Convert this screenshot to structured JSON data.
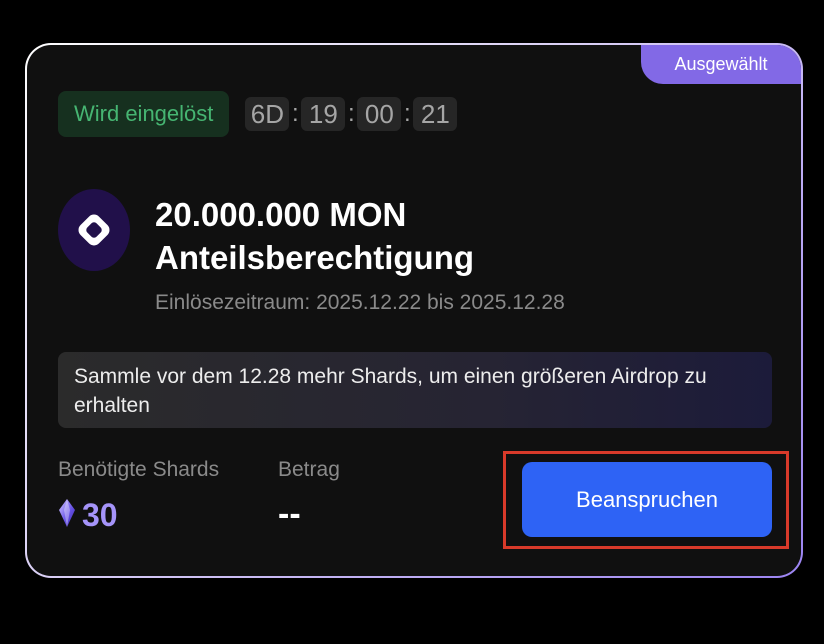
{
  "card": {
    "selected_badge": "Ausgewählt",
    "status": "Wird eingelöst",
    "countdown": {
      "days": "6D",
      "hours": "19",
      "minutes": "00",
      "seconds": "21",
      "separator": ":"
    },
    "token": {
      "icon": "monad-logo-icon",
      "title_line1": "20.000.000 MON",
      "title_line2": "Anteilsberechtigung",
      "redemption_period": "Einlösezeitraum: 2025.12.22 bis 2025.12.28"
    },
    "hint": "Sammle vor dem 12.28 mehr Shards, um einen größeren Airdrop zu erhalten",
    "required_shards": {
      "label": "Benötigte Shards",
      "icon": "crystal-shard-icon",
      "value": "30"
    },
    "amount": {
      "label": "Betrag",
      "value": "--"
    },
    "claim_button": "Beanspruchen"
  },
  "colors": {
    "accent_purple": "#8269e6",
    "status_green": "#46b572",
    "button_blue": "#2e63f5",
    "highlight_red": "#d83a2a"
  }
}
